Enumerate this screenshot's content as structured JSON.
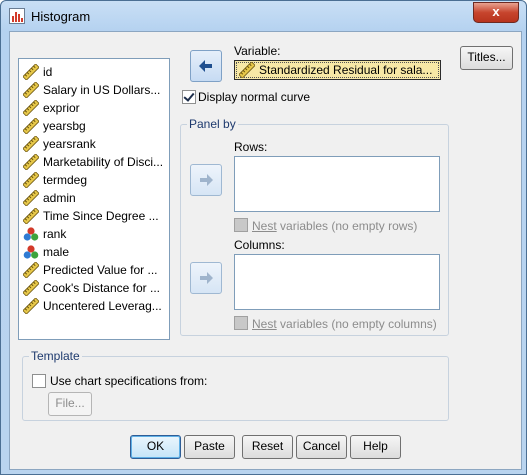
{
  "window": {
    "title": "Histogram",
    "close_glyph": "x"
  },
  "variables": [
    {
      "label": "id",
      "icon": "scale-ruler-icon"
    },
    {
      "label": "Salary in US Dollars...",
      "icon": "scale-ruler-icon"
    },
    {
      "label": "exprior",
      "icon": "scale-ruler-icon"
    },
    {
      "label": "yearsbg",
      "icon": "scale-ruler-icon"
    },
    {
      "label": "yearsrank",
      "icon": "scale-ruler-icon"
    },
    {
      "label": "Marketability of Disci...",
      "icon": "scale-ruler-icon"
    },
    {
      "label": "termdeg",
      "icon": "scale-ruler-icon"
    },
    {
      "label": "admin",
      "icon": "scale-ruler-icon"
    },
    {
      "label": "Time Since Degree ...",
      "icon": "scale-ruler-icon"
    },
    {
      "label": "rank",
      "icon": "nominal-balls-icon"
    },
    {
      "label": "male",
      "icon": "nominal-balls-icon"
    },
    {
      "label": "Predicted Value for ...",
      "icon": "scale-ruler-icon"
    },
    {
      "label": "Cook's Distance for ...",
      "icon": "scale-ruler-icon"
    },
    {
      "label": "Uncentered Leverag...",
      "icon": "scale-ruler-icon"
    }
  ],
  "variable": {
    "label": "Variable:",
    "value": "Standardized Residual for sala..."
  },
  "display_normal_curve": {
    "label": "Display normal curve",
    "checked": true
  },
  "panel_by": {
    "title": "Panel by",
    "rows_label": "Rows:",
    "nest_rows": "variables (no empty rows)",
    "nest_prefix": "Nest",
    "columns_label": "Columns:",
    "nest_columns": "variables (no empty columns)"
  },
  "template": {
    "title": "Template",
    "use_chart_spec": "Use chart specifications from:",
    "file_button": "File..."
  },
  "buttons": {
    "titles": "Titles...",
    "ok": "OK",
    "paste": "Paste",
    "reset": "Reset",
    "cancel": "Cancel",
    "help": "Help"
  }
}
